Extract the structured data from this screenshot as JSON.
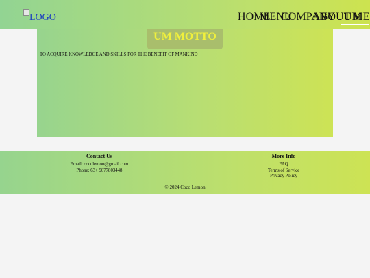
{
  "header": {
    "logo_alt": "LOGO",
    "nav": [
      {
        "label": "HOME"
      },
      {
        "label": "MENU"
      },
      {
        "label": "COMPANY"
      },
      {
        "label": "ABOUT ME"
      },
      {
        "label": "UM",
        "active": true
      }
    ]
  },
  "main": {
    "title": "UM MOTTO",
    "motto": "TO ACQUIRE KNOWLEDGE AND SKILLS FOR THE BENEFIT OF MANKIND"
  },
  "footer": {
    "contact": {
      "heading": "Contact Us",
      "email": "Email: cocolemon@gmail.com",
      "phone": "Phone: 63+ 9077803448"
    },
    "more_info": {
      "heading": "More Info",
      "links": [
        "FAQ",
        "Terms of Service",
        "Privacy Policy"
      ]
    },
    "copyright": "© 2024 Coco Lemon"
  },
  "colors": {
    "gradient_start": "#92d493",
    "gradient_end": "#cde34f",
    "motto_title": "#f4f23a",
    "motto_box": "#a9bd6c",
    "logo_link": "#1c3fbf"
  },
  "icons": {
    "logo": "broken-image-icon"
  }
}
